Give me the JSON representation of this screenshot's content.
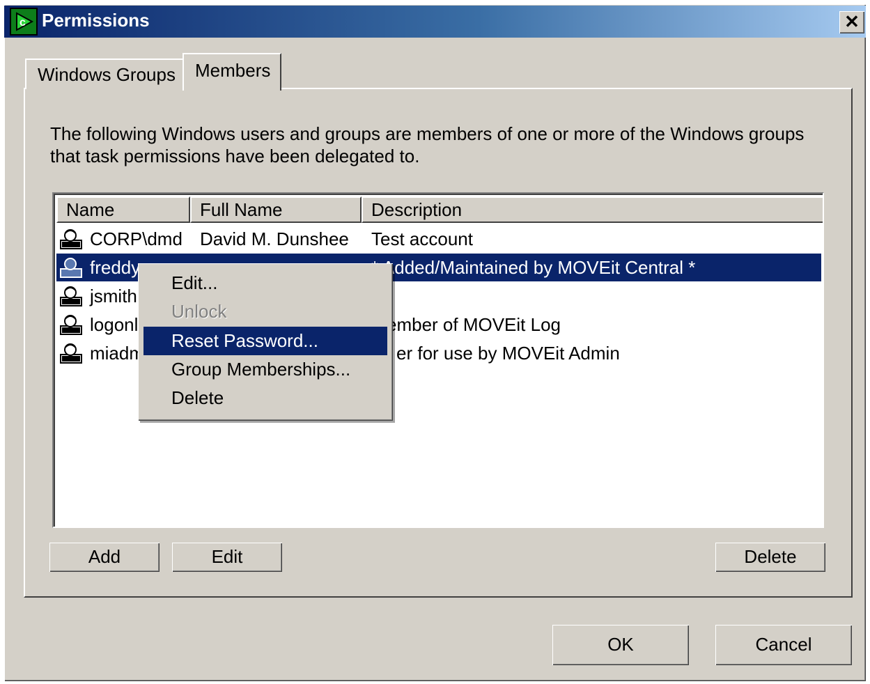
{
  "window": {
    "title": "Permissions",
    "close_label": "✕"
  },
  "tabs": [
    {
      "label": "Windows Groups"
    },
    {
      "label": "Members"
    }
  ],
  "intro_text": "The following Windows users and groups are members of one or more of the Windows groups that task permissions have been delegated to.",
  "table": {
    "columns": [
      "Name",
      "Full Name",
      "Description"
    ],
    "rows": [
      {
        "name": "CORP\\dmd",
        "full_name": "David M. Dunshee",
        "description": "Test account"
      },
      {
        "name": "freddy",
        "full_name": "",
        "description": "* Added/Maintained by MOVEit Central *"
      },
      {
        "name": "jsmith",
        "full_name": "",
        "description": ""
      },
      {
        "name": "logonl",
        "full_name": "",
        "description": "ember of MOVEit Log"
      },
      {
        "name": "miadm",
        "full_name": "",
        "description": "er for use by MOVEit Admin"
      }
    ],
    "selected_row": 1
  },
  "context_menu": {
    "items": [
      {
        "label": "Edit...",
        "enabled": true
      },
      {
        "label": "Unlock",
        "enabled": false
      },
      {
        "label": "Reset Password...",
        "enabled": true,
        "highlighted": true
      },
      {
        "label": "Group Memberships...",
        "enabled": true
      },
      {
        "label": "Delete",
        "enabled": true
      }
    ]
  },
  "buttons": {
    "add": "Add",
    "edit": "Edit",
    "delete": "Delete",
    "ok": "OK",
    "cancel": "Cancel"
  },
  "colors": {
    "title_start": "#0a246a",
    "title_end": "#a6caf0",
    "face": "#d4d0c8",
    "selection": "#0a246a"
  },
  "icons": {
    "app": "green-arrow-c-icon",
    "user": "user-icon",
    "close": "close-icon"
  }
}
